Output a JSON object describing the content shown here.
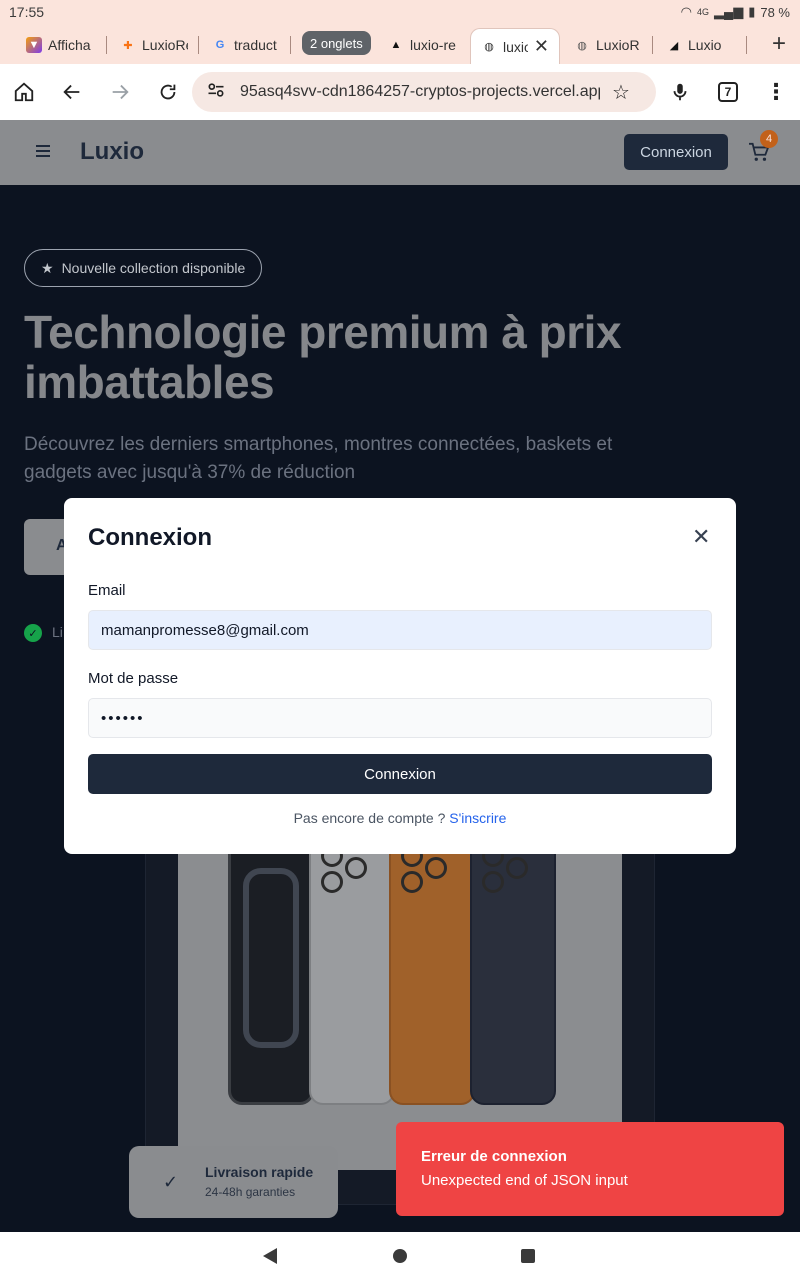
{
  "status_bar": {
    "time": "17:55",
    "network": "4G",
    "battery": "78 %"
  },
  "browser": {
    "tabs": [
      {
        "label": "Afficha"
      },
      {
        "label": "LuxioRe"
      },
      {
        "label": "traduct"
      },
      {
        "label": "luxio-re"
      },
      {
        "label": "luxio"
      },
      {
        "label": "LuxioR"
      },
      {
        "label": "Luxio"
      }
    ],
    "tab_group_label": "2 onglets",
    "url": "95asq4svv-cdn1864257-cryptos-projects.vercel.app",
    "tab_count": "7"
  },
  "site": {
    "brand": "Luxio",
    "header_login": "Connexion",
    "cart_count": "4",
    "hero": {
      "badge": "Nouvelle collection disponible",
      "title": "Technologie premium à prix imbattables",
      "subtitle": "Découvrez les derniers smartphones, montres connectées, baskets et gadgets avec jusqu'à 37% de réduction",
      "button_partial": "A",
      "feature_partial": "Li"
    },
    "delivery_card": {
      "title": "Livraison rapide",
      "subtitle": "24-48h garanties"
    }
  },
  "modal": {
    "title": "Connexion",
    "email_label": "Email",
    "email_value": "mamanpromesse8@gmail.com",
    "password_label": "Mot de passe",
    "password_value": "••••••",
    "submit_label": "Connexion",
    "signup_prompt": "Pas encore de compte ?",
    "signup_link": "S'inscrire"
  },
  "toast": {
    "title": "Erreur de connexion",
    "message": "Unexpected end of JSON input",
    "color": "#ef4444"
  }
}
